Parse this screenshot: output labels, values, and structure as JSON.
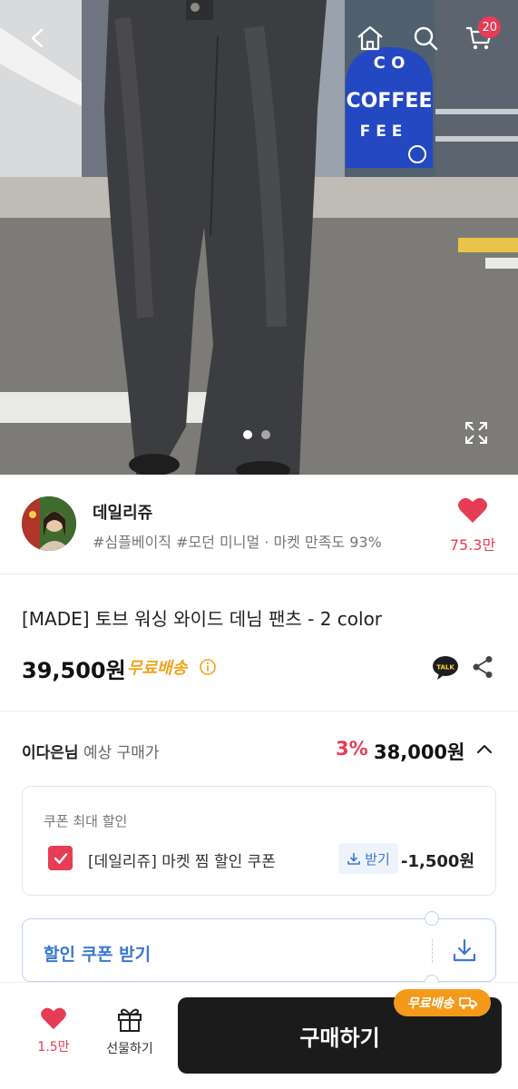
{
  "header": {
    "back_icon": "chevron-left-icon",
    "home_icon": "home-icon",
    "search_icon": "search-icon",
    "cart_icon": "cart-icon",
    "cart_count": "20"
  },
  "hero": {
    "signboard_top": "C O",
    "signboard_main": "COFFEE",
    "signboard_bottom": "F E E",
    "current_image": 1,
    "total_images": 2
  },
  "seller": {
    "name": "데일리쥬",
    "tags": "#심플베이직 #모던 미니멀 · 마켓 만족도 93%",
    "like_count": "75.3만"
  },
  "product": {
    "name": "[MADE] 토브 워싱 와이드 데님 팬츠 - 2 color",
    "price": "39,500원",
    "free_shipping": "무료배송",
    "talk_label": "TALK"
  },
  "expected": {
    "user_name": "이다은님",
    "label": "예상 구매가",
    "discount_pct": "3%",
    "price": "38,000원"
  },
  "coupon": {
    "title": "쿠폰 최대 할인",
    "item_name": "[데일리쥬] 마켓 찜 할인 쿠폰",
    "receive_label": "받기",
    "amount": "-1,500원",
    "checked": true
  },
  "get_coupon": {
    "label": "할인 쿠폰 받기"
  },
  "bottom_bar": {
    "like_count": "1.5만",
    "gift_label": "선물하기",
    "buy_label": "구매하기",
    "ship_badge": "무료배송"
  },
  "colors": {
    "accent_red": "#e63c56",
    "accent_blue": "#3b78d0",
    "ship_orange": "#f39a1b",
    "buy_button": "#1b1b1b"
  }
}
